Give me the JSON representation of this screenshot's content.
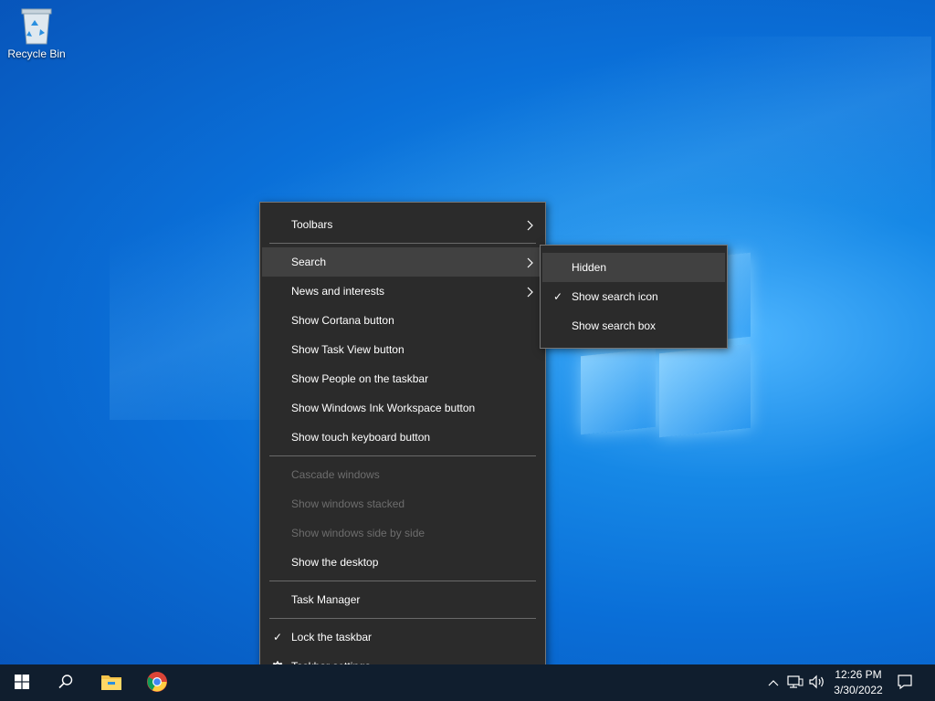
{
  "desktop": {
    "icons": [
      {
        "label": "Recycle Bin",
        "icon": "recycle-bin-icon"
      }
    ]
  },
  "context_menu": {
    "items": [
      {
        "label": "Toolbars",
        "submenu": true
      },
      {
        "label": "Search",
        "submenu": true,
        "highlighted": true
      },
      {
        "label": "News and interests",
        "submenu": true
      },
      {
        "label": "Show Cortana button"
      },
      {
        "label": "Show Task View button"
      },
      {
        "label": "Show People on the taskbar"
      },
      {
        "label": "Show Windows Ink Workspace button"
      },
      {
        "label": "Show touch keyboard button"
      },
      {
        "label": "Cascade windows",
        "disabled": true
      },
      {
        "label": "Show windows stacked",
        "disabled": true
      },
      {
        "label": "Show windows side by side",
        "disabled": true
      },
      {
        "label": "Show the desktop"
      },
      {
        "label": "Task Manager"
      },
      {
        "label": "Lock the taskbar",
        "checked": true
      },
      {
        "label": "Taskbar settings",
        "icon": "gear-icon"
      }
    ],
    "arrow_glyph": "›",
    "check_glyph": "✓"
  },
  "search_submenu": {
    "items": [
      {
        "label": "Hidden",
        "highlighted": true
      },
      {
        "label": "Show search icon",
        "checked": true
      },
      {
        "label": "Show search box"
      }
    ]
  },
  "taskbar": {
    "buttons": [
      "start-icon",
      "search-icon",
      "file-explorer-icon",
      "chrome-icon"
    ],
    "tray": [
      "chevron-up-icon",
      "network-icon",
      "volume-icon"
    ],
    "clock_time": "12:26 PM",
    "clock_date": "3/30/2022",
    "notification": "action-center-icon"
  }
}
